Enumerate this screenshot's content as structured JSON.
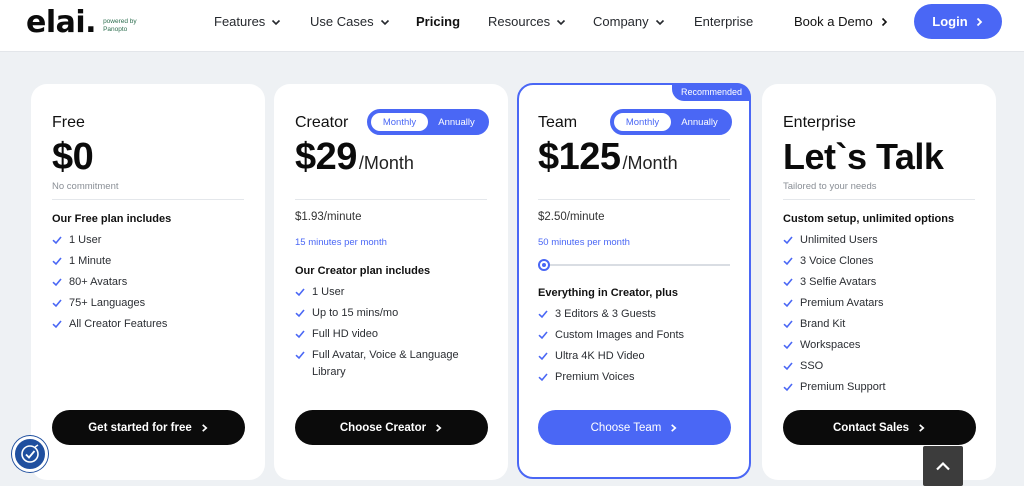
{
  "brand": {
    "logo": "elai.",
    "powered_line1": "powered by",
    "powered_line2": "Panopto"
  },
  "nav": {
    "items": [
      "Features",
      "Use Cases",
      "Pricing",
      "Resources",
      "Company",
      "Enterprise"
    ],
    "book_demo": "Book a Demo",
    "login": "Login"
  },
  "plans": [
    {
      "name": "Free",
      "price": "$0",
      "suffix": "",
      "note": "No commitment",
      "features_title": "Our Free plan includes",
      "features": [
        "1 User",
        "1 Minute",
        "80+ Avatars",
        "75+ Languages",
        "All Creator Features"
      ],
      "cta": "Get started for free"
    },
    {
      "name": "Creator",
      "price": "$29",
      "suffix": "/Month",
      "toggle": {
        "monthly": "Monthly",
        "annually": "Annually"
      },
      "rate": "$1.93/minute",
      "minutes": "15 minutes per month",
      "features_title": "Our Creator plan includes",
      "features": [
        "1 User",
        "Up to 15 mins/mo",
        "Full HD video",
        "Full Avatar, Voice & Language Library"
      ],
      "cta": "Choose Creator"
    },
    {
      "name": "Team",
      "price": "$125",
      "suffix": "/Month",
      "badge": "Recommended",
      "toggle": {
        "monthly": "Monthly",
        "annually": "Annually"
      },
      "rate": "$2.50/minute",
      "minutes": "50 minutes per month",
      "features_title": "Everything in Creator, plus",
      "features": [
        "3 Editors & 3 Guests",
        "Custom Images and Fonts",
        "Ultra 4K HD Video",
        "Premium Voices"
      ],
      "cta": "Choose Team"
    },
    {
      "name": "Enterprise",
      "price": "Let`s Talk",
      "suffix": "",
      "note": "Tailored to your needs",
      "features_title": "Custom setup, unlimited options",
      "features": [
        "Unlimited Users",
        "3 Voice Clones",
        "3 Selfie Avatars",
        "Premium Avatars",
        "Brand Kit",
        "Workspaces",
        "SSO",
        "Premium Support"
      ],
      "cta": "Contact Sales"
    }
  ],
  "colors": {
    "accent": "#4a67f5",
    "dark": "#0b0b0b",
    "background": "#eef1f4"
  },
  "icons": {
    "accessibility": "accessibility-icon",
    "scroll_top": "chevron-up-icon"
  }
}
